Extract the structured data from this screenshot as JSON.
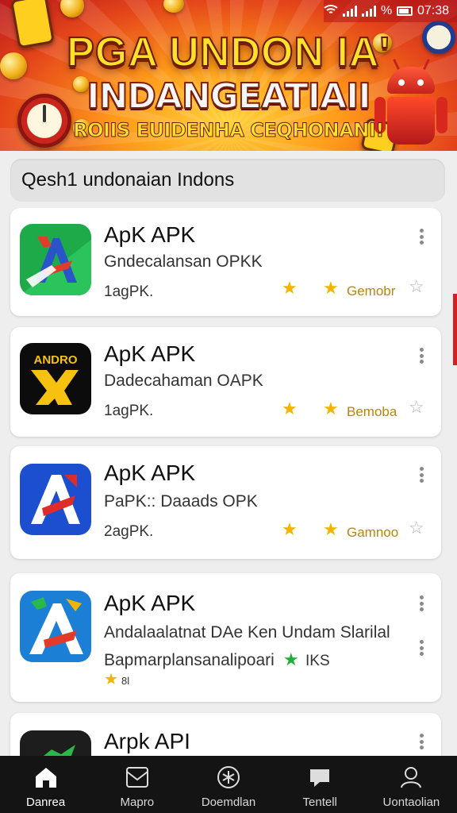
{
  "status_bar": {
    "battery": "%",
    "time": "07:38"
  },
  "banner": {
    "title_line1": "PGA UNDON IA'",
    "title_line2": "INDANGEATIAII",
    "title_line3": "ROIIS EUIDENHA CEQHONANI!"
  },
  "search": {
    "text": "Qesh1 undonaian Indons"
  },
  "apps": [
    {
      "title": "ApK APK",
      "subtitle": "Gndecalansan OPKK",
      "size": "1agPK.",
      "badge": "Gemobr",
      "icon": "app-a-green-icon"
    },
    {
      "title": "ApK APK",
      "subtitle": "Dadecahaman OAPK",
      "size": "1agPK.",
      "badge": "Bemoba",
      "icon": "app-andro-yellow-icon"
    },
    {
      "title": "ApK APK",
      "subtitle": "PaPK:: Daaads OPK",
      "size": "2agPK.",
      "badge": "Gamnoo",
      "icon": "app-a-blue-icon"
    },
    {
      "title": "ApK APK",
      "subtitle": "Andalaalatnat DAe Ken Undam Slarilal",
      "size": "Bapmarplansanalipoari",
      "extra": "IKS",
      "badge": "8l",
      "icon": "app-delta-icon"
    },
    {
      "title": "Arpk API",
      "icon": "app-dark-icon"
    }
  ],
  "nav": [
    {
      "label": "Danrea",
      "icon": "home-icon"
    },
    {
      "label": "Mapro",
      "icon": "map-icon"
    },
    {
      "label": "Doemdlan",
      "icon": "download-icon"
    },
    {
      "label": "Tentell",
      "icon": "chat-icon"
    },
    {
      "label": "Uontaolian",
      "icon": "user-icon"
    }
  ],
  "colors": {
    "banner": "#e5471a",
    "star": "#f3b400",
    "nav_bg": "#141414"
  }
}
